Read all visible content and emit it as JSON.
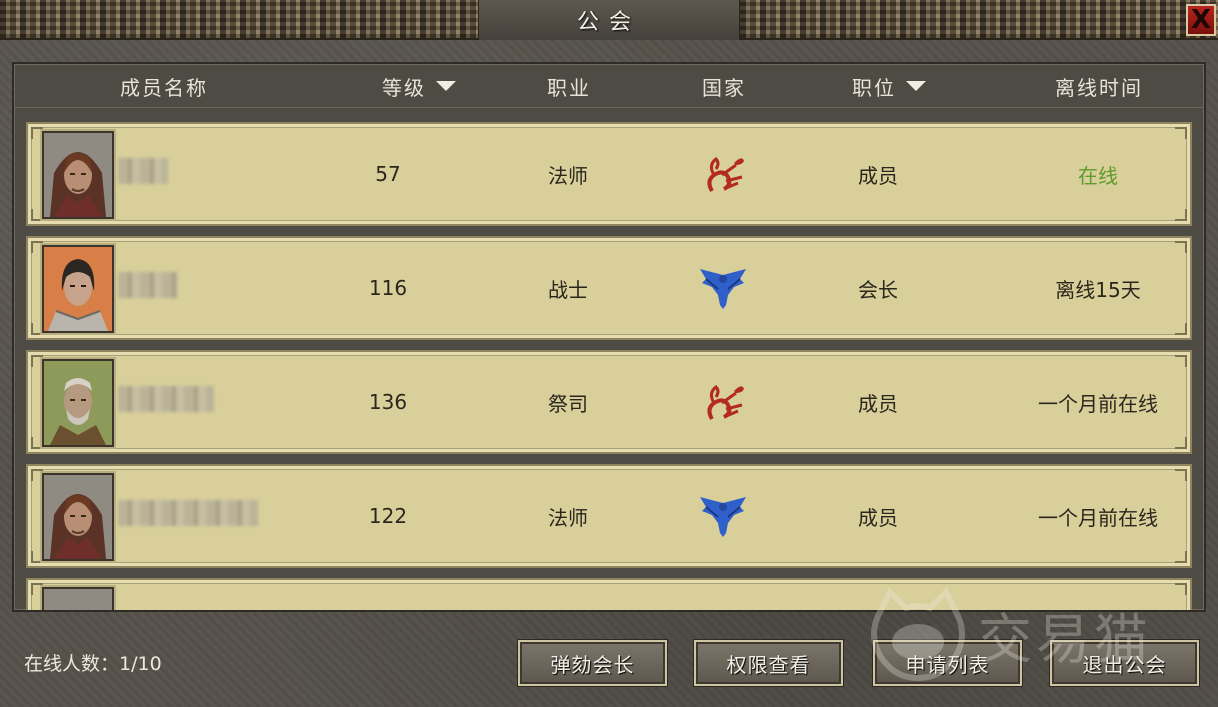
{
  "window": {
    "title": "公会",
    "close_label": "X"
  },
  "table": {
    "columns": [
      {
        "label": "成员名称",
        "sortable": false
      },
      {
        "label": "等级",
        "sortable": true
      },
      {
        "label": "职业",
        "sortable": false
      },
      {
        "label": "国家",
        "sortable": false
      },
      {
        "label": "职位",
        "sortable": true
      },
      {
        "label": "离线时间",
        "sortable": false
      }
    ],
    "rows": [
      {
        "portrait": "hooded-mage-portrait",
        "level": "57",
        "class": "法师",
        "nation_icon": "scorpion-icon",
        "position": "成员",
        "status": "在线",
        "status_color": "#5d9b2a"
      },
      {
        "portrait": "warrior-portrait",
        "level": "116",
        "class": "战士",
        "nation_icon": "eagle-icon",
        "position": "会长",
        "status": "离线15天",
        "status_color": "#2b261c"
      },
      {
        "portrait": "priest-portrait",
        "level": "136",
        "class": "祭司",
        "nation_icon": "scorpion-icon",
        "position": "成员",
        "status": "一个月前在线",
        "status_color": "#2b261c"
      },
      {
        "portrait": "hooded-mage-portrait",
        "level": "122",
        "class": "法师",
        "nation_icon": "eagle-icon",
        "position": "成员",
        "status": "一个月前在线",
        "status_color": "#2b261c"
      }
    ]
  },
  "footer": {
    "online_count_label": "在线人数：1/10",
    "buttons": {
      "impeach": "弹劾会长",
      "permissions": "权限查看",
      "applications": "申请列表",
      "leave": "退出公会"
    }
  },
  "watermark": {
    "text": "交易猫"
  },
  "colors": {
    "row_bg": "#d8cf9b",
    "scorpion": "#b22a22",
    "eagle": "#2f5fc9",
    "online": "#5d9b2a"
  }
}
